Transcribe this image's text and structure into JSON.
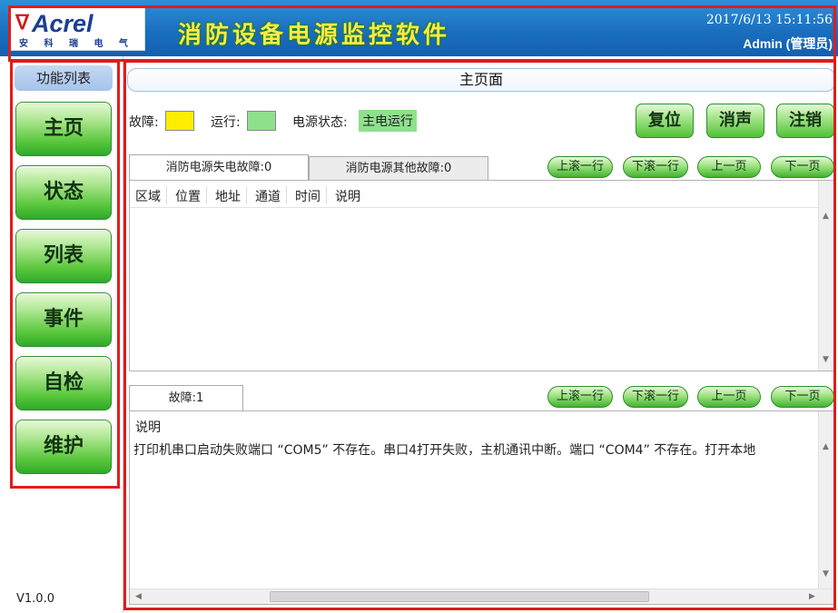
{
  "header": {
    "logo_brand": "Acrel",
    "logo_sub": "安 科 瑞 电 气",
    "app_title": "消防设备电源监控软件",
    "datetime": "2017/6/13 15:11:56",
    "user": "Admin (管理员)"
  },
  "sidebar": {
    "title": "功能列表",
    "items": [
      "主页",
      "状态",
      "列表",
      "事件",
      "自检",
      "维护"
    ],
    "version": "V1.0.0"
  },
  "main": {
    "page_title": "主页面",
    "status": {
      "fault_label": "故障:",
      "run_label": "运行:",
      "power_label": "电源状态:",
      "power_value": "主电运行",
      "fault_color": "#ffee00",
      "run_color": "#8fe08c"
    },
    "actions": {
      "reset": "复位",
      "mute": "消声",
      "logout": "注销"
    },
    "scroll": {
      "up_row": "上滚一行",
      "down_row": "下滚一行",
      "prev_page": "上一页",
      "next_page": "下一页"
    },
    "tabs_top": [
      "消防电源失电故障:0",
      "消防电源其他故障:0"
    ],
    "columns": [
      "区域",
      "位置",
      "地址",
      "通道",
      "时间",
      "说明"
    ],
    "tab_bottom": "故障:1",
    "bottom_header": "说明",
    "bottom_row": "打印机串口启动失败端口 “COM5” 不存在。串口4打开失败，主机通讯中断。端口 “COM4” 不存在。打开本地"
  },
  "colors": {
    "accent_red": "#e21b1b",
    "header_blue": "#1a6fbf",
    "button_green": "#52c138"
  }
}
